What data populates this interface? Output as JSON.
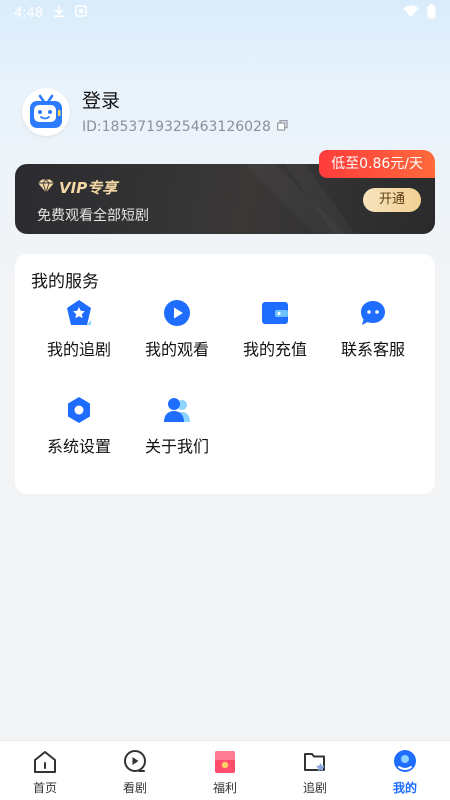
{
  "status_bar": {
    "time": "4:48",
    "icons": [
      "download-icon",
      "notification-icon",
      "wifi-icon",
      "battery-icon"
    ]
  },
  "profile": {
    "login_label": "登录",
    "user_id": "ID:1853719325463126028",
    "copy_icon": "copy-icon"
  },
  "vip": {
    "badge": "低至0.86元/天",
    "title": "VIP专享",
    "subtitle": "免费观看全部短剧",
    "open_button": "开通"
  },
  "services": {
    "title": "我的服务",
    "items": [
      {
        "label": "我的追剧",
        "icon": "star-folder-icon"
      },
      {
        "label": "我的观看",
        "icon": "play-icon"
      },
      {
        "label": "我的充值",
        "icon": "wallet-icon"
      },
      {
        "label": "联系客服",
        "icon": "chat-icon"
      },
      {
        "label": "系统设置",
        "icon": "settings-icon"
      },
      {
        "label": "关于我们",
        "icon": "users-icon"
      }
    ]
  },
  "bottom_nav": {
    "items": [
      {
        "label": "首页",
        "icon": "home-icon"
      },
      {
        "label": "看剧",
        "icon": "play-circle-icon"
      },
      {
        "label": "福利",
        "icon": "gift-icon"
      },
      {
        "label": "追剧",
        "icon": "folder-star-icon"
      },
      {
        "label": "我的",
        "icon": "profile-icon"
      }
    ],
    "active_index": 4
  },
  "colors": {
    "accent": "#1f6dff",
    "vip_badge": "#ff3b3b",
    "vip_gold": "#f3d7a4"
  }
}
